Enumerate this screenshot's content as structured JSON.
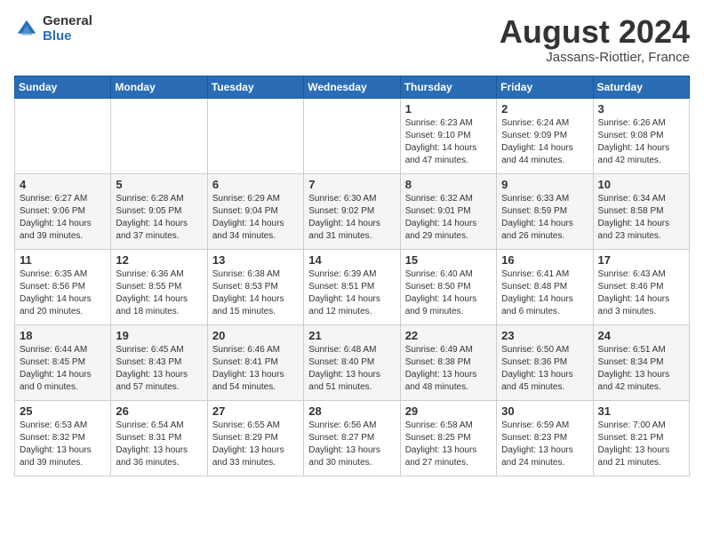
{
  "logo": {
    "general": "General",
    "blue": "Blue"
  },
  "title": {
    "month_year": "August 2024",
    "location": "Jassans-Riottier, France"
  },
  "weekdays": [
    "Sunday",
    "Monday",
    "Tuesday",
    "Wednesday",
    "Thursday",
    "Friday",
    "Saturday"
  ],
  "weeks": [
    [
      {
        "day": "",
        "info": ""
      },
      {
        "day": "",
        "info": ""
      },
      {
        "day": "",
        "info": ""
      },
      {
        "day": "",
        "info": ""
      },
      {
        "day": "1",
        "info": "Sunrise: 6:23 AM\nSunset: 9:10 PM\nDaylight: 14 hours and 47 minutes."
      },
      {
        "day": "2",
        "info": "Sunrise: 6:24 AM\nSunset: 9:09 PM\nDaylight: 14 hours and 44 minutes."
      },
      {
        "day": "3",
        "info": "Sunrise: 6:26 AM\nSunset: 9:08 PM\nDaylight: 14 hours and 42 minutes."
      }
    ],
    [
      {
        "day": "4",
        "info": "Sunrise: 6:27 AM\nSunset: 9:06 PM\nDaylight: 14 hours and 39 minutes."
      },
      {
        "day": "5",
        "info": "Sunrise: 6:28 AM\nSunset: 9:05 PM\nDaylight: 14 hours and 37 minutes."
      },
      {
        "day": "6",
        "info": "Sunrise: 6:29 AM\nSunset: 9:04 PM\nDaylight: 14 hours and 34 minutes."
      },
      {
        "day": "7",
        "info": "Sunrise: 6:30 AM\nSunset: 9:02 PM\nDaylight: 14 hours and 31 minutes."
      },
      {
        "day": "8",
        "info": "Sunrise: 6:32 AM\nSunset: 9:01 PM\nDaylight: 14 hours and 29 minutes."
      },
      {
        "day": "9",
        "info": "Sunrise: 6:33 AM\nSunset: 8:59 PM\nDaylight: 14 hours and 26 minutes."
      },
      {
        "day": "10",
        "info": "Sunrise: 6:34 AM\nSunset: 8:58 PM\nDaylight: 14 hours and 23 minutes."
      }
    ],
    [
      {
        "day": "11",
        "info": "Sunrise: 6:35 AM\nSunset: 8:56 PM\nDaylight: 14 hours and 20 minutes."
      },
      {
        "day": "12",
        "info": "Sunrise: 6:36 AM\nSunset: 8:55 PM\nDaylight: 14 hours and 18 minutes."
      },
      {
        "day": "13",
        "info": "Sunrise: 6:38 AM\nSunset: 8:53 PM\nDaylight: 14 hours and 15 minutes."
      },
      {
        "day": "14",
        "info": "Sunrise: 6:39 AM\nSunset: 8:51 PM\nDaylight: 14 hours and 12 minutes."
      },
      {
        "day": "15",
        "info": "Sunrise: 6:40 AM\nSunset: 8:50 PM\nDaylight: 14 hours and 9 minutes."
      },
      {
        "day": "16",
        "info": "Sunrise: 6:41 AM\nSunset: 8:48 PM\nDaylight: 14 hours and 6 minutes."
      },
      {
        "day": "17",
        "info": "Sunrise: 6:43 AM\nSunset: 8:46 PM\nDaylight: 14 hours and 3 minutes."
      }
    ],
    [
      {
        "day": "18",
        "info": "Sunrise: 6:44 AM\nSunset: 8:45 PM\nDaylight: 14 hours and 0 minutes."
      },
      {
        "day": "19",
        "info": "Sunrise: 6:45 AM\nSunset: 8:43 PM\nDaylight: 13 hours and 57 minutes."
      },
      {
        "day": "20",
        "info": "Sunrise: 6:46 AM\nSunset: 8:41 PM\nDaylight: 13 hours and 54 minutes."
      },
      {
        "day": "21",
        "info": "Sunrise: 6:48 AM\nSunset: 8:40 PM\nDaylight: 13 hours and 51 minutes."
      },
      {
        "day": "22",
        "info": "Sunrise: 6:49 AM\nSunset: 8:38 PM\nDaylight: 13 hours and 48 minutes."
      },
      {
        "day": "23",
        "info": "Sunrise: 6:50 AM\nSunset: 8:36 PM\nDaylight: 13 hours and 45 minutes."
      },
      {
        "day": "24",
        "info": "Sunrise: 6:51 AM\nSunset: 8:34 PM\nDaylight: 13 hours and 42 minutes."
      }
    ],
    [
      {
        "day": "25",
        "info": "Sunrise: 6:53 AM\nSunset: 8:32 PM\nDaylight: 13 hours and 39 minutes."
      },
      {
        "day": "26",
        "info": "Sunrise: 6:54 AM\nSunset: 8:31 PM\nDaylight: 13 hours and 36 minutes."
      },
      {
        "day": "27",
        "info": "Sunrise: 6:55 AM\nSunset: 8:29 PM\nDaylight: 13 hours and 33 minutes."
      },
      {
        "day": "28",
        "info": "Sunrise: 6:56 AM\nSunset: 8:27 PM\nDaylight: 13 hours and 30 minutes."
      },
      {
        "day": "29",
        "info": "Sunrise: 6:58 AM\nSunset: 8:25 PM\nDaylight: 13 hours and 27 minutes."
      },
      {
        "day": "30",
        "info": "Sunrise: 6:59 AM\nSunset: 8:23 PM\nDaylight: 13 hours and 24 minutes."
      },
      {
        "day": "31",
        "info": "Sunrise: 7:00 AM\nSunset: 8:21 PM\nDaylight: 13 hours and 21 minutes."
      }
    ]
  ]
}
